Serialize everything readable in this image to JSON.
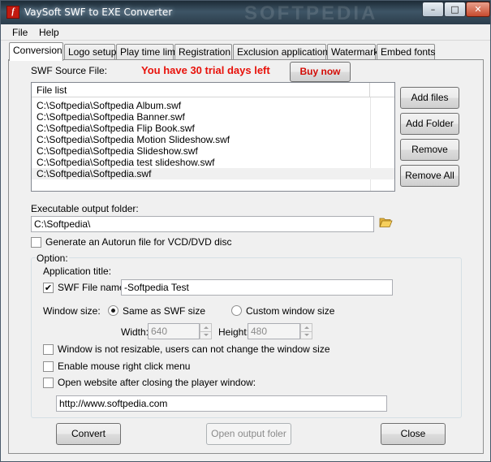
{
  "window": {
    "title": "VaySoft SWF to EXE Converter",
    "app_icon_glyph": "f",
    "watermark": "SOFTPEDIA",
    "minimize_glyph": "–",
    "maximize_glyph": "□",
    "close_glyph": "✕"
  },
  "menu": [
    "File",
    "Help"
  ],
  "tabs": [
    "Conversion",
    "Logo setup",
    "Play time limit",
    "Registration",
    "Exclusion applications",
    "Watermark",
    "Embed fonts"
  ],
  "conversion": {
    "source_label": "SWF Source File:",
    "trial_text": "You have 30 trial days left",
    "buy_button": "Buy now",
    "file_list_header": "File list",
    "files": [
      "C:\\Softpedia\\Softpedia Album.swf",
      "C:\\Softpedia\\Softpedia Banner.swf",
      "C:\\Softpedia\\Softpedia Flip Book.swf",
      "C:\\Softpedia\\Softpedia Motion Slideshow.swf",
      "C:\\Softpedia\\Softpedia Slideshow.swf",
      "C:\\Softpedia\\Softpedia test slideshow.swf",
      "C:\\Softpedia\\Softpedia.swf"
    ],
    "add_files": "Add files",
    "add_folder": "Add Folder",
    "remove": "Remove",
    "remove_all": "Remove All",
    "output_label": "Executable output folder:",
    "output_value": "C:\\Softpedia\\",
    "autorun_label": "Generate an Autorun file for VCD/DVD disc",
    "autorun_checked": false,
    "option_legend": "Option:",
    "app_title_label": "Application title:",
    "swf_file_name_label": "SWF File name",
    "swf_file_name_checked": true,
    "swf_file_name_value": "-Softpedia Test",
    "window_size_label": "Window size:",
    "same_as_swf": "Same as SWF size",
    "custom_window": "Custom window size",
    "window_size_selected": "Same as SWF size",
    "width_label": "Width:",
    "width_value": "640",
    "height_label": "Height:",
    "height_value": "480",
    "not_resizable_label": "Window is not resizable, users can not change the window size",
    "right_click_label": "Enable mouse right click menu",
    "open_website_label": "Open website after closing the player window:",
    "website_value": "http://www.softpedia.com",
    "check_glyph": "✔"
  },
  "footer": {
    "convert": "Convert",
    "open_output": "Open output foler",
    "close": "Close"
  }
}
